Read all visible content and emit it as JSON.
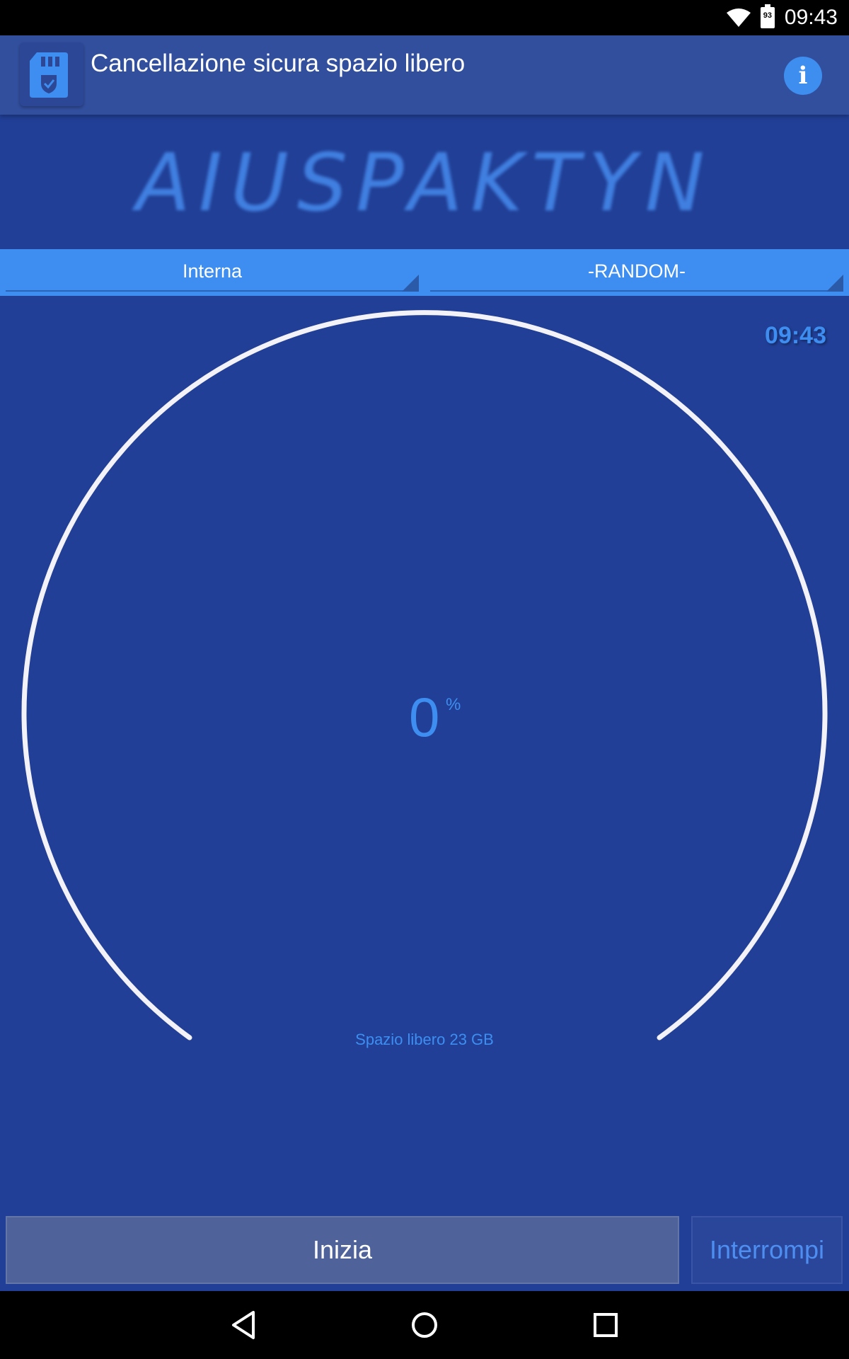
{
  "status_bar": {
    "time": "09:43",
    "battery_level": "93",
    "icons": [
      "wifi-icon",
      "battery-icon"
    ]
  },
  "app_bar": {
    "title": "Cancellazione sicura spazio libero",
    "app_icon": "sd-card-shield-icon",
    "info_icon": "i"
  },
  "logo": {
    "text": "AIUSPAKTYN"
  },
  "selectors": {
    "storage": {
      "selected": "Interna"
    },
    "method": {
      "selected": "-RANDOM-"
    }
  },
  "progress": {
    "clock": "09:43",
    "percent_value": "0",
    "percent_unit": "%",
    "fraction": 0,
    "free_space": "Spazio libero 23 GB"
  },
  "buttons": {
    "start_label": "Inizia",
    "stop_label": "Interrompi"
  },
  "nav_bar": {
    "icons": [
      "back-icon",
      "home-icon",
      "recents-icon"
    ]
  },
  "colors": {
    "background": "#213f96",
    "accent": "#3d8ef0",
    "app_bar": "#324f9e",
    "gauge_ring": "#f2f2f8"
  }
}
